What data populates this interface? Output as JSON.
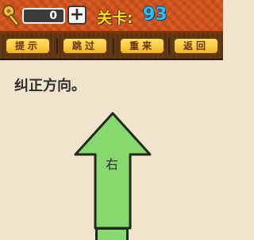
{
  "header": {
    "key_icon": "key-icon",
    "coins": "0",
    "plus_symbol": "+",
    "level_label": "关卡:",
    "level_number": "93"
  },
  "toolbar": {
    "hint_label": "提示",
    "skip_label": "跳过",
    "retry_label": "重来",
    "back_label": "返回"
  },
  "puzzle": {
    "question": "纠正方向。",
    "arrow_text": "右",
    "arrow_direction": "up",
    "arrow_color": "#86d96f"
  },
  "colors": {
    "top_bar": "#d6541c",
    "button_bar": "#5b3513",
    "background": "#f1e4cd",
    "level_label": "#ffe31e",
    "level_number": "#24c2ff"
  }
}
